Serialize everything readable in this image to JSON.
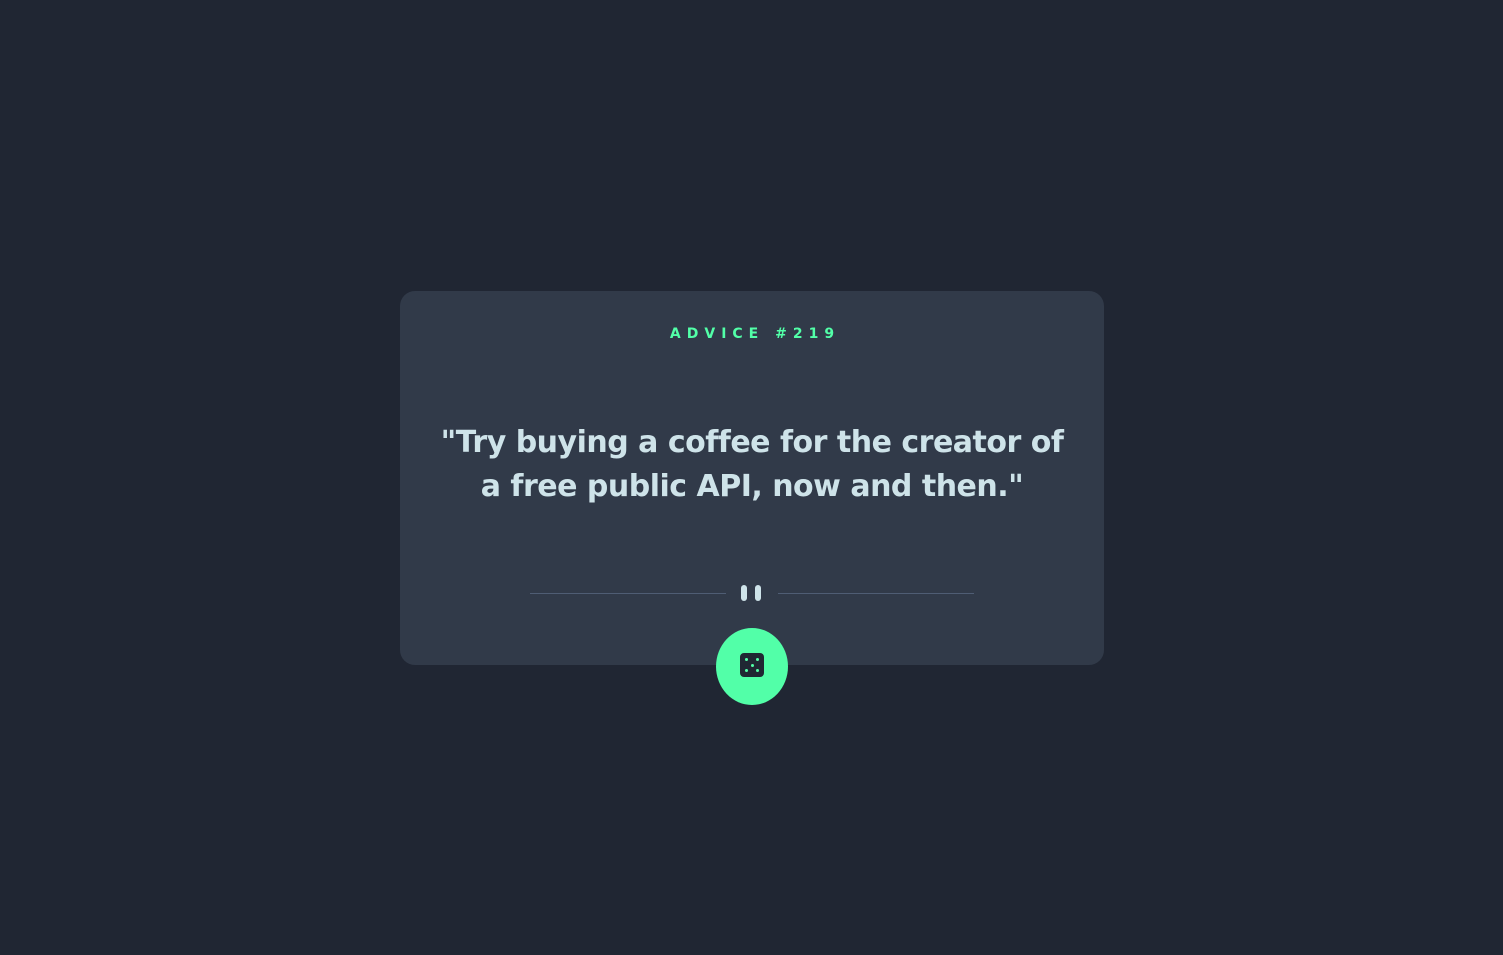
{
  "card": {
    "advice_label": "ADVICE #219",
    "quote": "\"Try buying a coffee for the creator of a free public API, now and then.\""
  },
  "icons": {
    "divider_icon": "pause-icon",
    "button_icon": "dice-icon"
  },
  "colors": {
    "background": "#202633",
    "card": "#313a49",
    "accent": "#52ffa8",
    "text": "#cee3e9",
    "divider": "#4f5d74"
  }
}
